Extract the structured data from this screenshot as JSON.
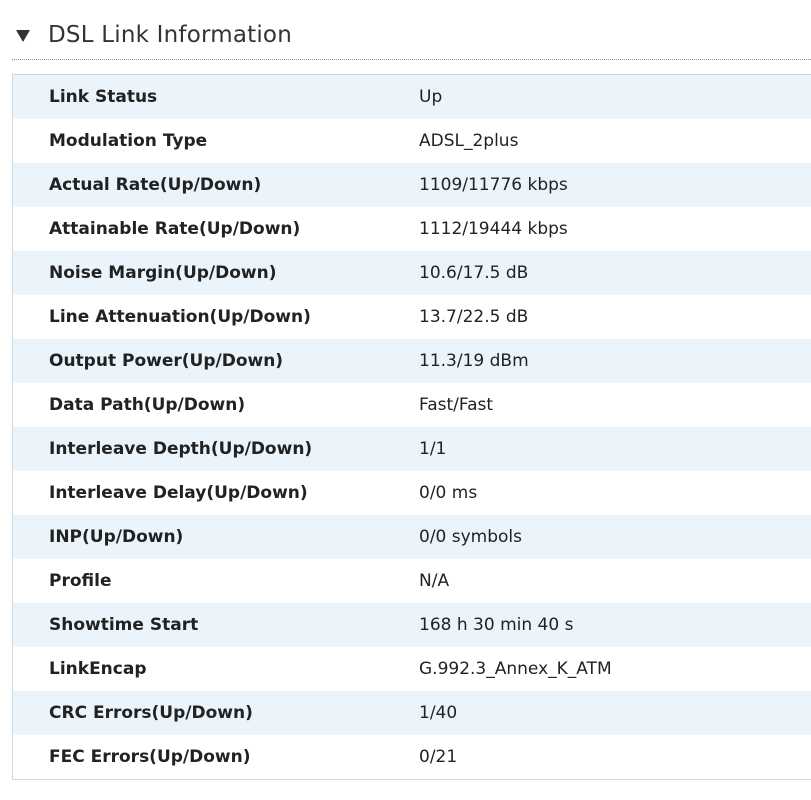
{
  "section": {
    "title": "DSL Link Information",
    "toggle_icon": "triangle-down-icon"
  },
  "rows": [
    {
      "label": "Link Status",
      "value": "Up"
    },
    {
      "label": "Modulation Type",
      "value": "ADSL_2plus"
    },
    {
      "label": "Actual Rate(Up/Down)",
      "value": "1109/11776 kbps"
    },
    {
      "label": "Attainable Rate(Up/Down)",
      "value": "1112/19444 kbps"
    },
    {
      "label": "Noise Margin(Up/Down)",
      "value": "10.6/17.5 dB"
    },
    {
      "label": "Line Attenuation(Up/Down)",
      "value": "13.7/22.5 dB"
    },
    {
      "label": "Output Power(Up/Down)",
      "value": "11.3/19 dBm"
    },
    {
      "label": "Data Path(Up/Down)",
      "value": "Fast/Fast"
    },
    {
      "label": "Interleave Depth(Up/Down)",
      "value": "1/1"
    },
    {
      "label": "Interleave Delay(Up/Down)",
      "value": "0/0 ms"
    },
    {
      "label": "INP(Up/Down)",
      "value": "0/0 symbols"
    },
    {
      "label": "Profile",
      "value": "N/A"
    },
    {
      "label": "Showtime Start",
      "value": "168 h 30 min 40 s"
    },
    {
      "label": "LinkEncap",
      "value": "G.992.3_Annex_K_ATM"
    },
    {
      "label": "CRC Errors(Up/Down)",
      "value": "1/40"
    },
    {
      "label": "FEC Errors(Up/Down)",
      "value": "0/21"
    }
  ]
}
